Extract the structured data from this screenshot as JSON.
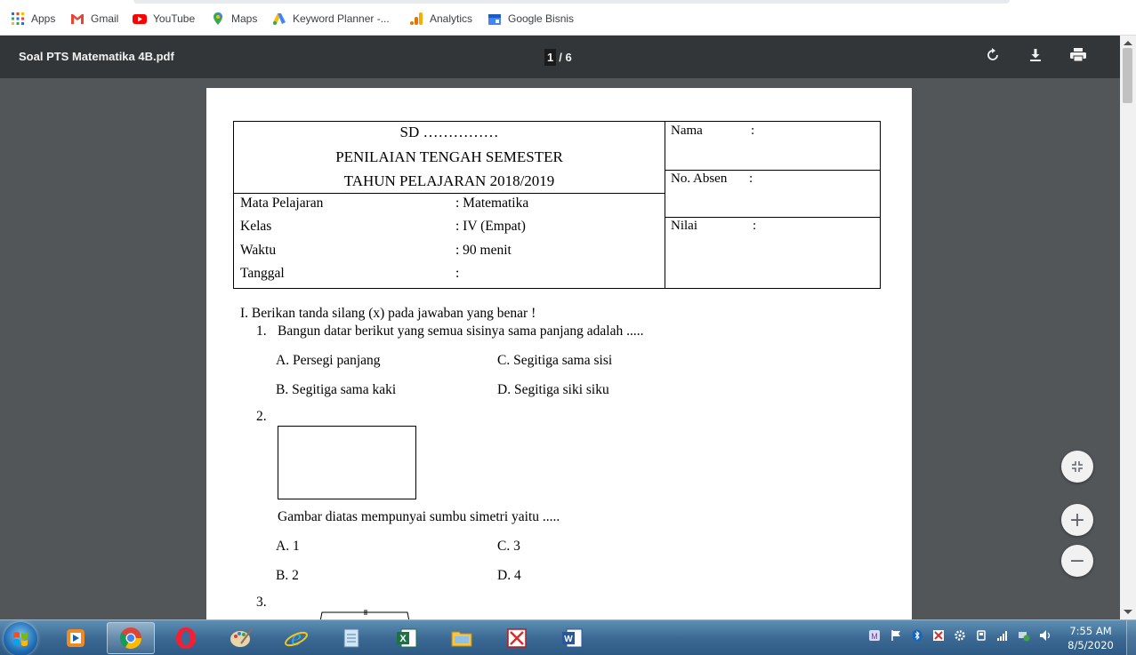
{
  "bookmarks": [
    {
      "label": "Apps",
      "icon": "apps-grid-icon"
    },
    {
      "label": "Gmail",
      "icon": "gmail-icon"
    },
    {
      "label": "YouTube",
      "icon": "youtube-icon"
    },
    {
      "label": "Maps",
      "icon": "maps-pin-icon"
    },
    {
      "label": "Keyword Planner -...",
      "icon": "google-ads-icon"
    },
    {
      "label": "Analytics",
      "icon": "analytics-icon"
    },
    {
      "label": "Google Bisnis",
      "icon": "google-business-icon"
    }
  ],
  "pdf": {
    "filename": "Soal PTS Matematika 4B.pdf",
    "page_current": "1",
    "page_total": "/ 6"
  },
  "document": {
    "school": "SD ……………",
    "exam_title": "PENILAIAN TENGAH SEMESTER",
    "year": "TAHUN PELAJARAN 2018/2019",
    "info": [
      {
        "label": "Mata Pelajaran",
        "value": ": Matematika"
      },
      {
        "label": "Kelas",
        "value": ": IV (Empat)"
      },
      {
        "label": "Waktu",
        "value": ": 90 menit"
      },
      {
        "label": "Tanggal",
        "value": ":"
      }
    ],
    "side": [
      {
        "label": "Nama",
        "colon": ":"
      },
      {
        "label": "No. Absen",
        "colon": ":"
      },
      {
        "label": "Nilai",
        "colon": ":"
      }
    ],
    "section_instruction": "I.  Berikan tanda silang (x) pada jawaban yang benar !",
    "q1": {
      "number": "1.",
      "text": "Bangun datar berikut yang semua sisinya sama panjang adalah .....",
      "options": [
        "A.  Persegi panjang",
        "C.  Segitiga sama sisi",
        "B.  Segitiga sama kaki",
        "D.  Segitiga siki siku"
      ]
    },
    "q2": {
      "number": "2.",
      "text": "Gambar diatas mempunyai sumbu simetri yaitu .....",
      "options": [
        "A.  1",
        "C.  3",
        "B.  2",
        "D.  4"
      ]
    },
    "q3": {
      "number": "3."
    }
  },
  "zoom": {
    "fit": "fit-page-icon",
    "plus": "+",
    "minus": "−"
  },
  "taskbar": {
    "time": "7:55 AM",
    "date": "8/5/2020",
    "apps": [
      "media-player-icon",
      "chrome-icon",
      "opera-icon",
      "paint-icon",
      "internet-explorer-icon",
      "notepad-icon",
      "excel-icon",
      "file-explorer-icon",
      "acrobat-icon",
      "word-icon"
    ]
  },
  "colors": {
    "toolbar": "#323639",
    "viewer_bg": "#525659",
    "taskbar": "#3c6a94"
  }
}
